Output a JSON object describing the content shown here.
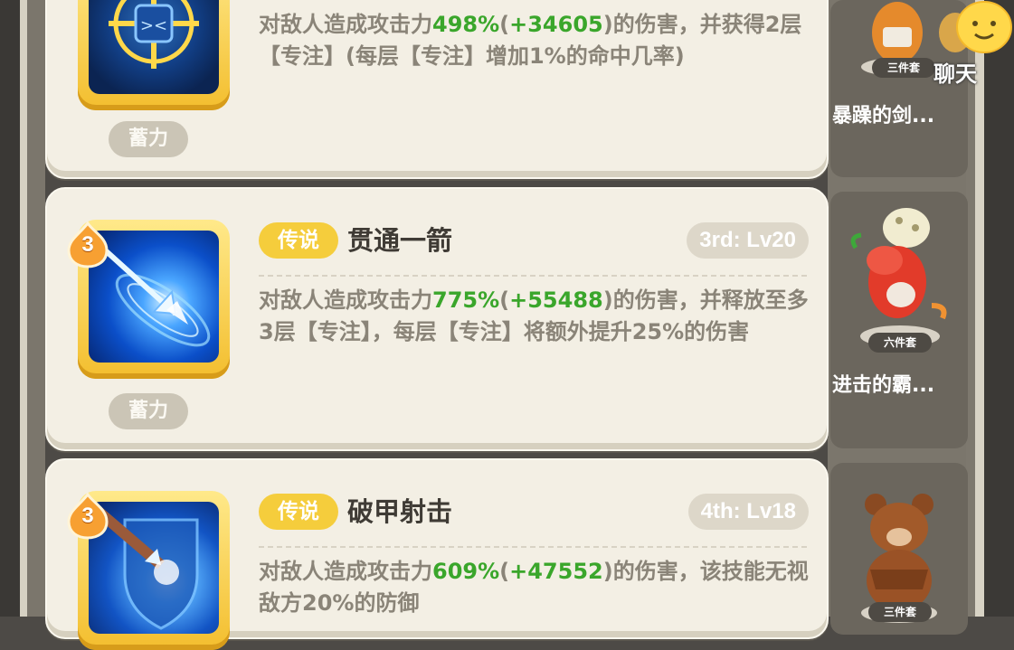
{
  "skills": [
    {
      "tag": "蓄力",
      "desc_pre": "对敌人造成攻击力",
      "pct": "498%",
      "paren_open": "(",
      "bonus": "+34605",
      "paren_close": ")",
      "desc_post": "的伤害，并获得2层【专注】(每层【专注】增加1%的命中几率)"
    },
    {
      "level": "3",
      "rarity": "传说",
      "name": "贯通一箭",
      "unlock": "3rd: Lv20",
      "tag": "蓄力",
      "desc_pre": "对敌人造成攻击力",
      "pct": "775%",
      "paren_open": "(",
      "bonus": "+55488",
      "paren_close": ")",
      "desc_post": "的伤害，并释放至多3层【专注】，每层【专注】将额外提升25%的伤害"
    },
    {
      "level": "3",
      "rarity": "传说",
      "name": "破甲射击",
      "unlock": "4th: Lv18",
      "desc_pre": "对敌人造成攻击力",
      "pct": "609%",
      "paren_open": "(",
      "bonus": "+47552",
      "paren_close": ")",
      "desc_post": "的伤害，该技能无视敌方20%的防御"
    }
  ],
  "sets": [
    {
      "label": "三件套",
      "name": "暴躁的剑..."
    },
    {
      "label": "六件套",
      "name": "进击的霸..."
    },
    {
      "label": "三件套"
    }
  ],
  "chat": {
    "label": "聊天"
  },
  "icons": [
    "target-skill-icon",
    "piercing-arrow-icon",
    "armor-break-arrow-icon",
    "fire-level-badge-icon",
    "chat-bubble-icon"
  ]
}
